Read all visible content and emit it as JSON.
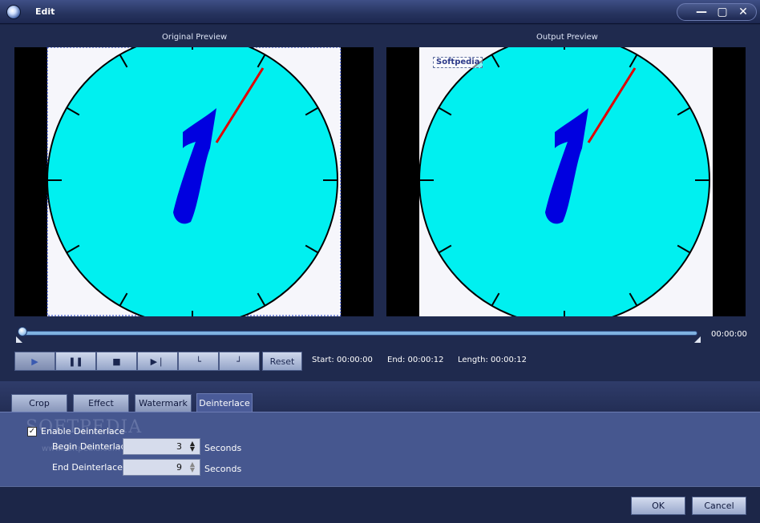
{
  "window": {
    "title": "Edit"
  },
  "previews": {
    "original_label": "Original Preview",
    "output_label": "Output Preview",
    "output_watermark": "Softpedia",
    "clock_digit": "1"
  },
  "timeline": {
    "current_time": "00:00:00",
    "position": 0.0
  },
  "controls": {
    "reset_label": "Reset",
    "start": "Start: 00:00:00",
    "end": "End: 00:00:12",
    "length": "Length: 00:00:12"
  },
  "tabs": [
    {
      "label": "Crop",
      "active": false
    },
    {
      "label": "Effect",
      "active": false
    },
    {
      "label": "Watermark",
      "active": false
    },
    {
      "label": "Deinterlace",
      "active": true
    }
  ],
  "deinterlace": {
    "enable_label": "Enable Deinterlace",
    "enabled": true,
    "begin_label": "Begin Deinterlace",
    "begin_value": "3",
    "end_label": "End Deinterlace",
    "end_value": "9",
    "unit": "Seconds",
    "watermark_text": "SOFTPEDIA",
    "watermark_url": "www.softpedia.com"
  },
  "footer": {
    "ok_label": "OK",
    "cancel_label": "Cancel"
  },
  "colors": {
    "clock_face": "#00f0f0",
    "hand": "#e00000",
    "digit": "#0000e0",
    "accent": "#46578f"
  }
}
